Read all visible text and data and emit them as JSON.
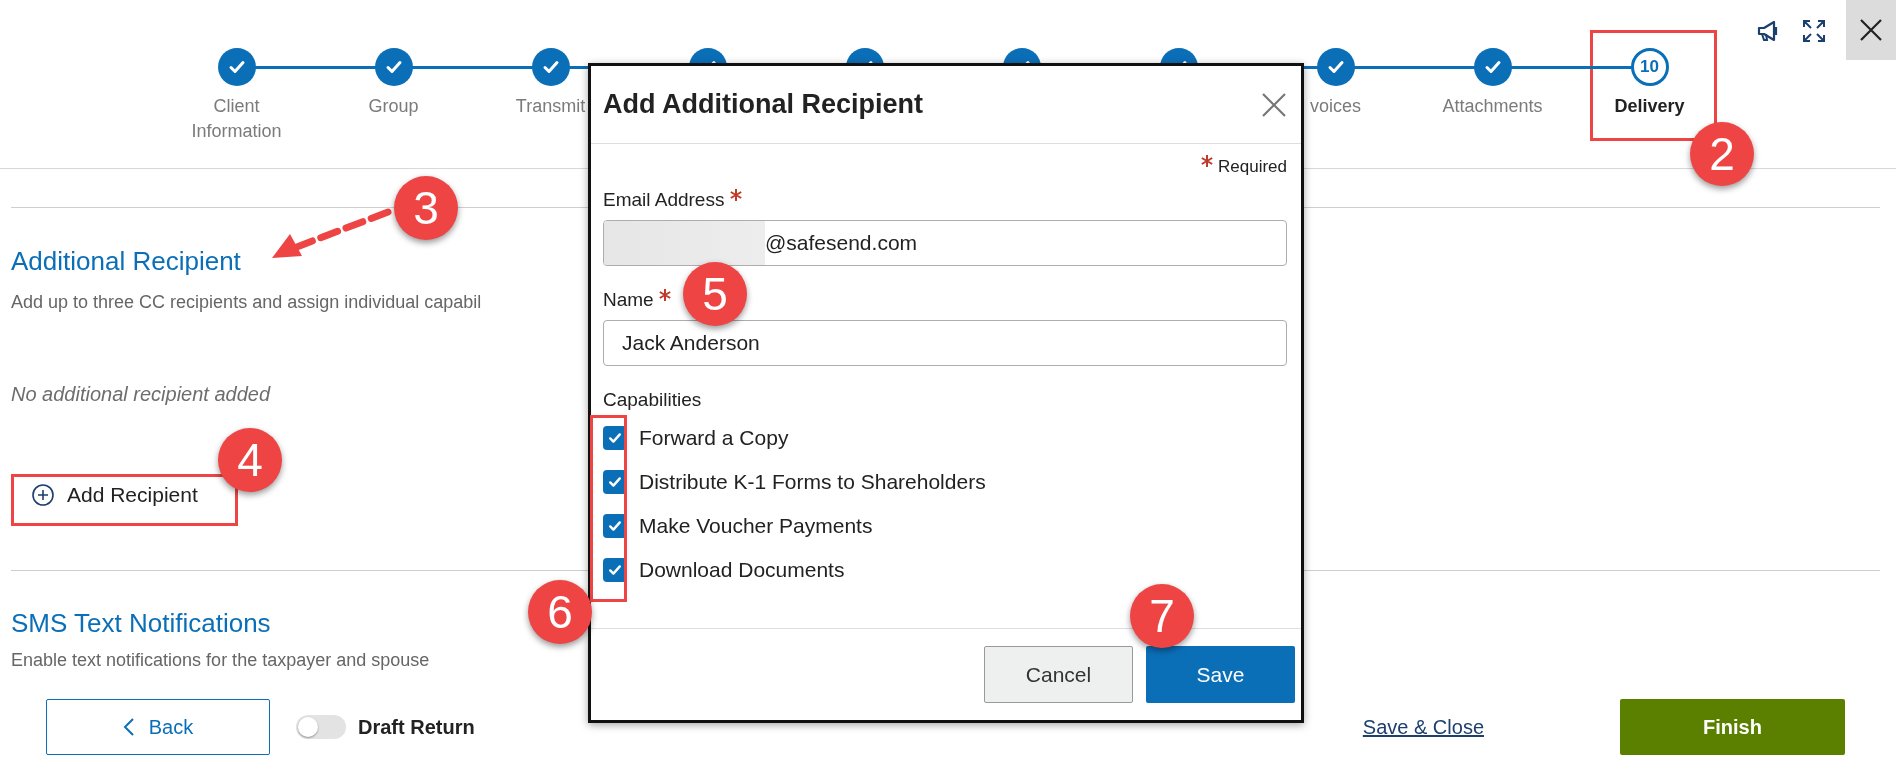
{
  "steps": [
    {
      "label": "Client Information",
      "completed": true,
      "selected": false
    },
    {
      "label": "Group",
      "completed": true,
      "selected": false
    },
    {
      "label": "Transmit",
      "completed": true,
      "selected": false
    },
    {
      "completed": true
    },
    {
      "completed": true
    },
    {
      "completed": true
    },
    {
      "completed": true
    },
    {
      "label": "voices",
      "completed": true,
      "selected": false
    },
    {
      "label": "Attachments",
      "completed": true,
      "selected": false
    },
    {
      "label": "Delivery",
      "selected": true,
      "number": "10"
    }
  ],
  "sections": [
    {
      "title": "Additional Recipient",
      "description": "Add up to three CC recipients and assign individual capabil",
      "empty_text": "No additional recipient added",
      "button": "Add Recipient"
    },
    {
      "title": "SMS Text Notifications",
      "description": "Enable text notifications for the taxpayer and spouse"
    }
  ],
  "footer": {
    "back": "Back",
    "draft_toggle": {
      "label": "Draft Return",
      "on": false
    },
    "save_close": "Save & Close",
    "finish": "Finish"
  },
  "modal": {
    "title": "Add Additional Recipient",
    "required_note": "Required",
    "email": {
      "label": "Email Address",
      "required": true,
      "value": "@safesend.com",
      "redacted": true
    },
    "name": {
      "label": "Name",
      "required": true,
      "value": "Jack Anderson"
    },
    "capabilities_label": "Capabilities",
    "capabilities": [
      {
        "label": "Forward a Copy",
        "checked": true
      },
      {
        "label": "Distribute K-1 Forms to Shareholders",
        "checked": true
      },
      {
        "label": "Make Voucher Payments",
        "checked": true
      },
      {
        "label": "Download Documents",
        "checked": true
      }
    ],
    "cancel": "Cancel",
    "save": "Save"
  },
  "annotations": [
    {
      "number": "2"
    },
    {
      "number": "3"
    },
    {
      "number": "4"
    },
    {
      "number": "5"
    },
    {
      "number": "6"
    },
    {
      "number": "7"
    }
  ]
}
